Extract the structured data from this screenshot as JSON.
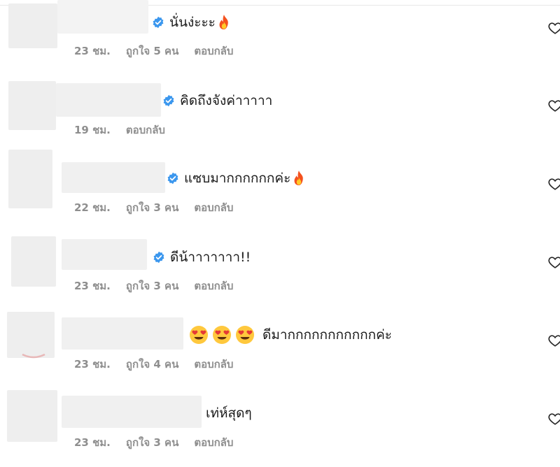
{
  "comments": [
    {
      "text": "นั่นง่ะะะ",
      "verified": true,
      "emoji_after": "fire-emoji",
      "time": "23 ชม.",
      "likes": "ถูกใจ 5 คน",
      "reply": "ตอบกลับ"
    },
    {
      "text": "คิดถึงจังค่าาาาา",
      "verified": true,
      "time": "19 ชม.",
      "reply": "ตอบกลับ"
    },
    {
      "text": "แซบมากกกกกกค่ะ",
      "verified": true,
      "emoji_after": "fire-emoji",
      "time": "22 ชม.",
      "likes": "ถูกใจ 3 คน",
      "reply": "ตอบกลับ"
    },
    {
      "text": "ดีน้าาาาาาา!!",
      "verified": true,
      "time": "23 ชม.",
      "likes": "ถูกใจ 3 คน",
      "reply": "ตอบกลับ"
    },
    {
      "text": "ดีมากกกกกกกกกกกค่ะ",
      "verified": false,
      "emoji_before": [
        "heart-eyes-emoji",
        "heart-eyes-emoji",
        "heart-eyes-emoji"
      ],
      "time": "23 ชม.",
      "likes": "ถูกใจ 4 คน",
      "reply": "ตอบกลับ"
    },
    {
      "text": "เท่ห์สุดๆ",
      "verified": false,
      "time": "23 ชม.",
      "likes": "ถูกใจ 3 คน",
      "reply": "ตอบกลับ"
    }
  ],
  "icons": {
    "verified": "verified-badge-icon",
    "like": "heart-outline-icon"
  },
  "colors": {
    "verified": "#3b97ee",
    "meta_text": "#8e8e8e",
    "text": "#1a1a1a"
  }
}
